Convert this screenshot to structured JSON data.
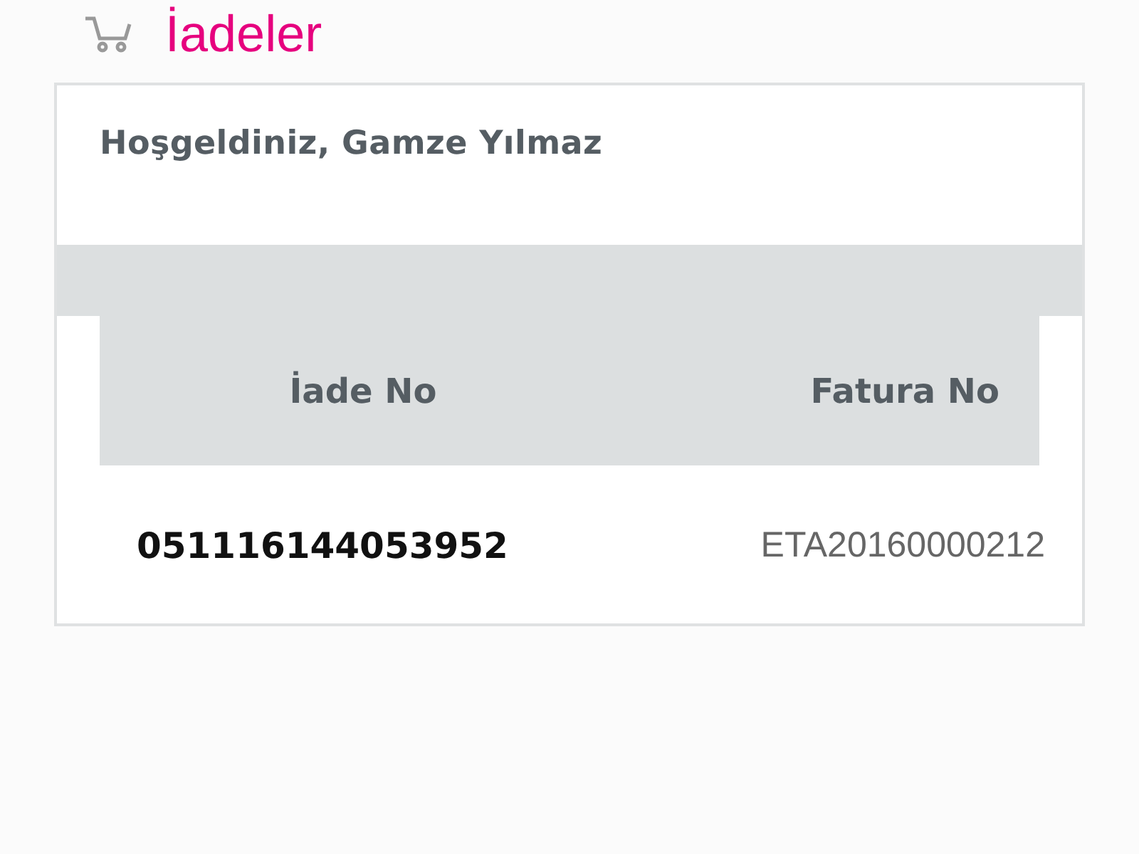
{
  "page": {
    "title": "İadeler"
  },
  "card": {
    "greeting": "Hoşgeldiniz, Gamze Yılmaz"
  },
  "table": {
    "columns": [
      "İade No",
      "Fatura No"
    ],
    "rows": [
      [
        "051116144053952",
        "ETA20160000212"
      ]
    ]
  }
}
